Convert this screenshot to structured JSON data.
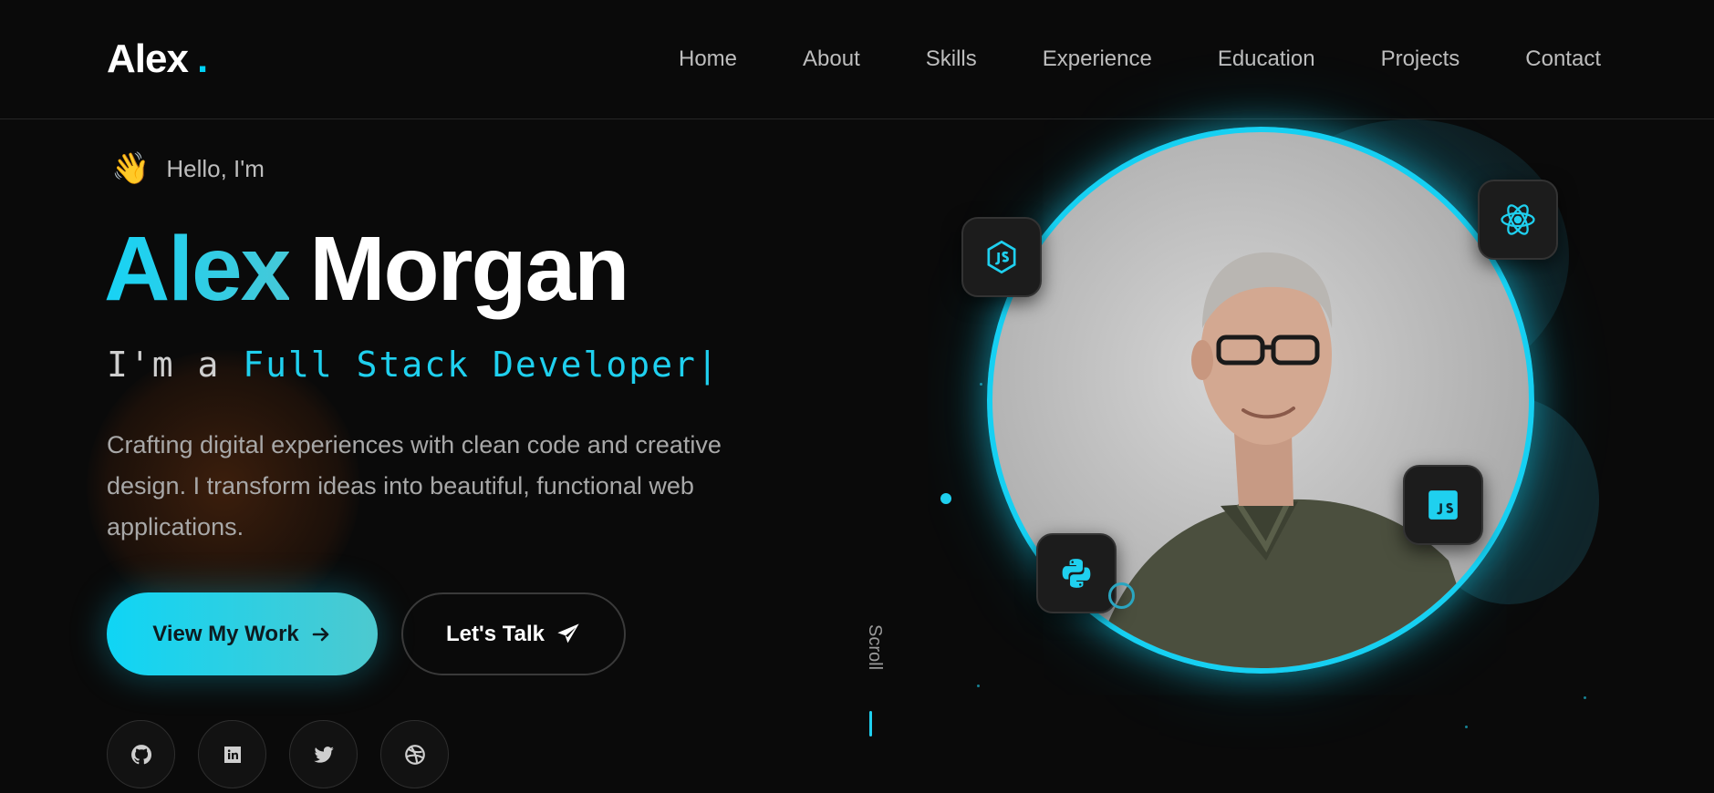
{
  "nav": {
    "logo_text": "Alex",
    "logo_dot": ".",
    "items": [
      "Home",
      "About",
      "Skills",
      "Experience",
      "Education",
      "Projects",
      "Contact"
    ]
  },
  "hero": {
    "greeting": "Hello, I'm",
    "wave_emoji": "👋",
    "first_name": "Alex",
    "last_name": "Morgan",
    "role_prefix": "I'm a ",
    "role_highlight": "Full Stack Developer",
    "caret": "|",
    "description": "Crafting digital experiences with clean code and creative design. I transform ideas into beautiful, functional web applications.",
    "primary_button": "View My Work",
    "secondary_button": "Let's Talk",
    "socials": [
      "github-icon",
      "linkedin-icon",
      "twitter-icon",
      "dribbble-icon"
    ],
    "scroll_label": "Scroll"
  },
  "tech_icons": [
    "nodejs-icon",
    "react-icon",
    "javascript-icon",
    "python-icon"
  ],
  "colors": {
    "accent": "#16d0f2",
    "background": "#0a0a0a"
  }
}
